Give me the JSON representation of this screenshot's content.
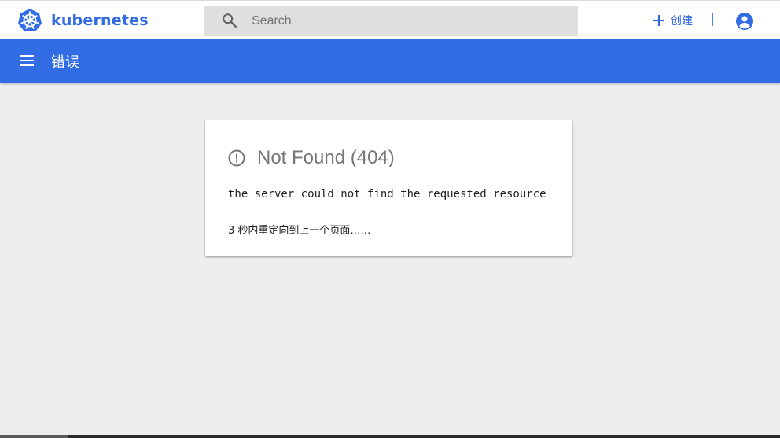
{
  "header": {
    "brand_name": "kubernetes",
    "search": {
      "placeholder": "Search",
      "value": ""
    },
    "create_label": "创建"
  },
  "toolbar": {
    "title": "错误"
  },
  "error": {
    "title": "Not Found (404)",
    "message": "the server could not find the requested resource",
    "redirect": "3 秒内重定向到上一个页面……"
  },
  "colors": {
    "brand": "#326ce5",
    "toolbar_bg": "#326ce5",
    "page_bg": "#eeeeee",
    "search_bg": "#dfdfdf",
    "title_text": "#757575"
  },
  "icons": {
    "logo": "kubernetes-logo-icon",
    "search": "search-icon",
    "create": "plus-icon",
    "account": "account-circle-icon",
    "menu": "menu-icon",
    "error": "error-outline-icon"
  }
}
